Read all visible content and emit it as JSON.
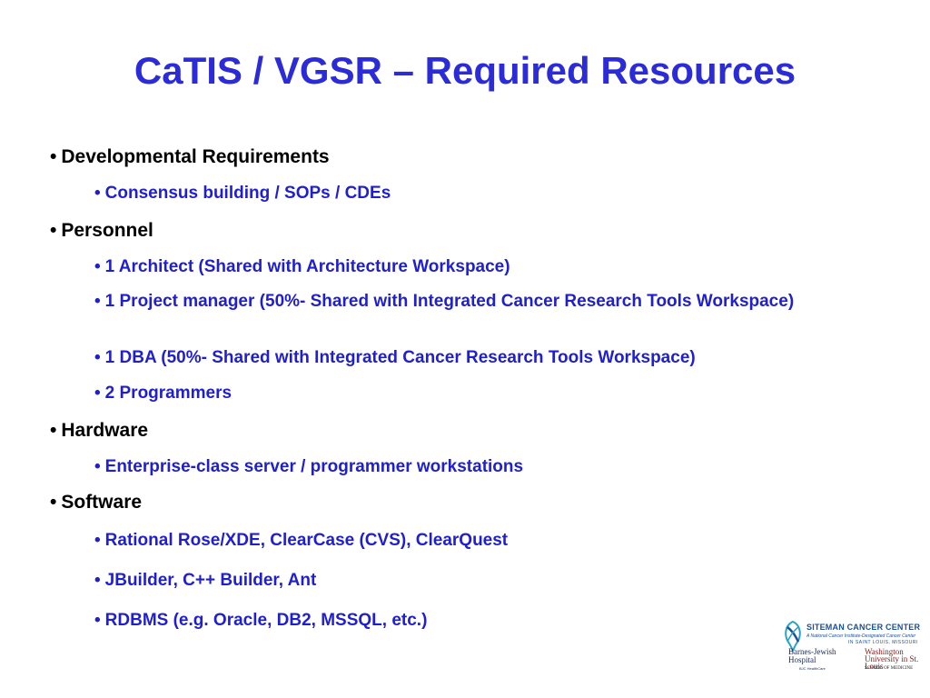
{
  "colors": {
    "title": "#2b2bd8",
    "level1": "#000000",
    "level2": "#1f1fd0",
    "logo_blue": "#1a4f9a",
    "logo_teal": "#2aa3c9",
    "logo_red": "#8b1a1a"
  },
  "slide": {
    "title": "CaTIS / VGSR – Required Resources",
    "bullet_char": "•",
    "sections": [
      {
        "label": "Developmental Requirements",
        "items": [
          "Consensus building / SOPs / CDEs"
        ]
      },
      {
        "label": "Personnel",
        "items": [
          "1 Architect (Shared with Architecture Workspace)",
          "1 Project manager (50%- Shared with Integrated Cancer Research Tools Workspace)",
          "1 DBA (50%- Shared with Integrated Cancer Research Tools Workspace)",
          "2 Programmers"
        ]
      },
      {
        "label": "Hardware",
        "items": [
          "Enterprise-class server  / programmer workstations"
        ]
      },
      {
        "label": "Software",
        "items": [
          "Rational Rose/XDE, ClearCase (CVS), ClearQuest",
          "JBuilder, C++ Builder, Ant",
          "RDBMS (e.g. Oracle, DB2, MSSQL, etc.)"
        ]
      }
    ]
  },
  "logo": {
    "emblem_icon": "siteman-ribbon-icon",
    "line1": "SITEMAN CANCER CENTER",
    "line2": "A National Cancer Institute-Designated Cancer Center",
    "line3": "IN SAINT LOUIS, MISSOURI",
    "bjh": "Barnes-Jewish Hospital",
    "bjh_sub": "BJC HealthCare",
    "wu": "Washington University in St. Louis",
    "wu_sub": "SCHOOL OF MEDICINE"
  }
}
